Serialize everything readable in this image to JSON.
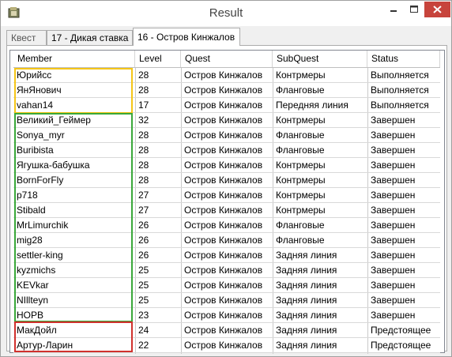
{
  "window": {
    "title": "Result"
  },
  "tabs": [
    {
      "label": "Квест"
    },
    {
      "label": "17 - Дикая ставка"
    },
    {
      "label": "16 - Остров Кинжалов"
    }
  ],
  "grid": {
    "columns": [
      "Member",
      "Level",
      "Quest",
      "SubQuest",
      "Status"
    ],
    "rows": [
      [
        "Юрийсс",
        "28",
        "Остров Кинжалов",
        "Контрмеры",
        "Выполняется"
      ],
      [
        "ЯнЯнович",
        "28",
        "Остров Кинжалов",
        "Фланговые",
        "Выполняется"
      ],
      [
        "vahan14",
        "17",
        "Остров Кинжалов",
        "Передняя линия",
        "Выполняется"
      ],
      [
        "Великий_Геймер",
        "32",
        "Остров Кинжалов",
        "Контрмеры",
        "Завершен"
      ],
      [
        "Sonya_myr",
        "28",
        "Остров Кинжалов",
        "Фланговые",
        "Завершен"
      ],
      [
        "Buribista",
        "28",
        "Остров Кинжалов",
        "Фланговые",
        "Завершен"
      ],
      [
        "Ягушка-бабушка",
        "28",
        "Остров Кинжалов",
        "Контрмеры",
        "Завершен"
      ],
      [
        "BornForFly",
        "28",
        "Остров Кинжалов",
        "Контрмеры",
        "Завершен"
      ],
      [
        "p718",
        "27",
        "Остров Кинжалов",
        "Контрмеры",
        "Завершен"
      ],
      [
        "Stibald",
        "27",
        "Остров Кинжалов",
        "Контрмеры",
        "Завершен"
      ],
      [
        "MrLimurchik",
        "26",
        "Остров Кинжалов",
        "Фланговые",
        "Завершен"
      ],
      [
        "mig28",
        "26",
        "Остров Кинжалов",
        "Фланговые",
        "Завершен"
      ],
      [
        "settler-king",
        "26",
        "Остров Кинжалов",
        "Задняя линия",
        "Завершен"
      ],
      [
        "kyzmichs",
        "25",
        "Остров Кинжалов",
        "Задняя линия",
        "Завершен"
      ],
      [
        "KEVkar",
        "25",
        "Остров Кинжалов",
        "Задняя линия",
        "Завершен"
      ],
      [
        "NIllteyn",
        "25",
        "Остров Кинжалов",
        "Задняя линия",
        "Завершен"
      ],
      [
        "HOPB",
        "23",
        "Остров Кинжалов",
        "Задняя линия",
        "Завершен"
      ],
      [
        "МакДойл",
        "24",
        "Остров Кинжалов",
        "Задняя линия",
        "Предстоящее"
      ],
      [
        "Артур-Ларин",
        "22",
        "Остров Кинжалов",
        "Задняя линия",
        "Предстоящее"
      ]
    ]
  },
  "highlight_colors": {
    "in_progress": "#f5c518",
    "completed": "#3aa83a",
    "upcoming": "#d0312d"
  },
  "icons": {
    "app": "app-icon",
    "minimize": "minimize-icon",
    "maximize": "maximize-icon",
    "close": "close-icon"
  }
}
